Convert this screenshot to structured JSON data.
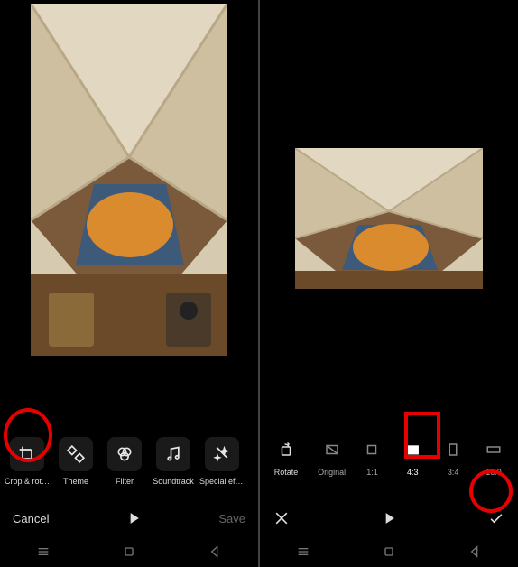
{
  "left": {
    "tools": [
      {
        "label": "Crop & rot…",
        "icon": "crop"
      },
      {
        "label": "Theme",
        "icon": "theme"
      },
      {
        "label": "Filter",
        "icon": "filter"
      },
      {
        "label": "Soundtrack",
        "icon": "music"
      },
      {
        "label": "Special eff…",
        "icon": "sparkle"
      }
    ],
    "cancel": "Cancel",
    "save": "Save"
  },
  "right": {
    "rotate": "Rotate",
    "aspects": [
      {
        "label": "Original",
        "shape": "orig"
      },
      {
        "label": "1:1",
        "shape": "sq"
      },
      {
        "label": "4:3",
        "shape": "w43",
        "selected": true
      },
      {
        "label": "3:4",
        "shape": "h34"
      },
      {
        "label": "16:9",
        "shape": "w169"
      }
    ]
  }
}
